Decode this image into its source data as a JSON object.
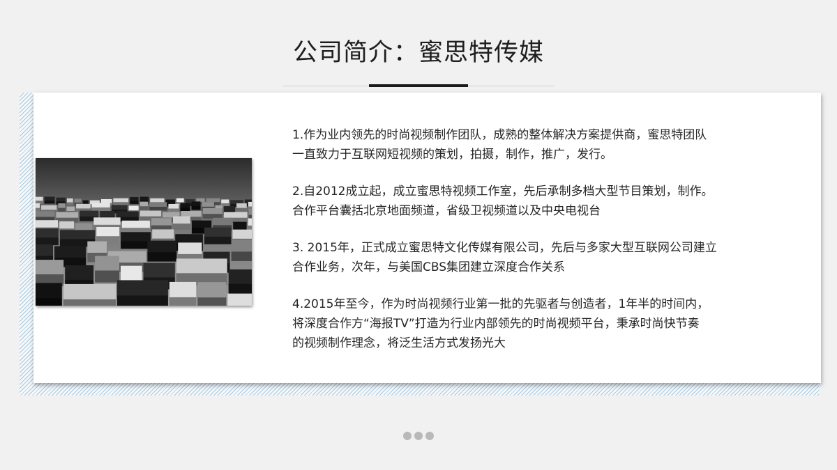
{
  "slide": {
    "title": "公司简介：蜜思特传媒",
    "paragraphs": [
      {
        "lines": [
          "1.作为业内领先的时尚视频制作团队，成熟的整体解决方案提供商，蜜思特团队",
          "一直致力于互联网短视频的策划，拍摄，制作，推广，发行。"
        ]
      },
      {
        "lines": [
          "2.自2012成立起，成立蜜思特视频工作室，先后承制多档大型节目策划，制作。",
          "合作平台囊括北京地面频道，省级卫视频道以及中央电视台"
        ]
      },
      {
        "lines": [
          "3. 2015年，正式成立蜜思特文化传媒有限公司，先后与多家大型互联网公司建立",
          "合作业务，次年，与美国CBS集团建立深度合作关系"
        ]
      },
      {
        "lines": [
          "4.2015年至今，作为时尚视频行业第一批的先驱者与创造者，1年半的时间内，",
          "将深度合作方“海报TV”打造为行业内部领先的时尚视频平台，秉承时尚快节奏",
          "的视频制作理念，将泛生活方式发扬光大"
        ]
      }
    ],
    "image": {
      "icon": "architecture-photo"
    },
    "pagination": {
      "dot_count": 3
    },
    "colors": {
      "background": "#f1f1f1",
      "card": "#ffffff",
      "accent_line": "#1a1a1a",
      "hatch": "#a9c7da"
    }
  }
}
